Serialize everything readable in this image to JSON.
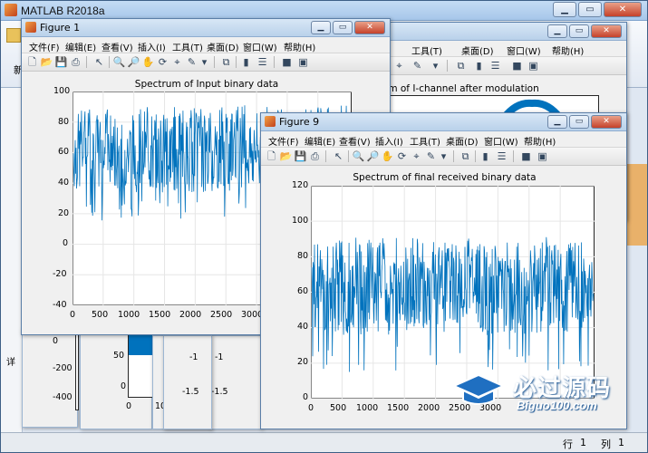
{
  "main_window": {
    "title": "MATLAB R2018a",
    "ribbon_text": "新",
    "left_text": "详",
    "status_row_label": "行",
    "status_row_value": "1",
    "status_col_label": "列",
    "status_col_value": "1"
  },
  "window_buttons": {
    "minimize": "▁",
    "maximize": "▭",
    "close": "✕"
  },
  "menu": [
    "文件(F)",
    "编辑(E)",
    "查看(V)",
    "插入(I)",
    "工具(T)",
    "桌面(D)",
    "窗口(W)",
    "帮助(H)"
  ],
  "toolbar_icons": [
    "new-file-icon",
    "open-folder-icon",
    "save-icon",
    "print-icon",
    "pointer-icon",
    "zoom-in-icon",
    "zoom-out-icon",
    "pan-hand-icon",
    "rotate-icon",
    "data-cursor-icon",
    "brush-icon",
    "dropdown-arrow-icon",
    "link-icon",
    "colorbar-icon",
    "legend-icon",
    "hide-plot-tools-icon",
    "show-plot-tools-icon"
  ],
  "figure1": {
    "title": "Figure 1",
    "plot_title": "Spectrum of Input binary data",
    "yticks": [
      "100",
      "80",
      "60",
      "40",
      "20",
      "0",
      "-20",
      "-40"
    ],
    "xticks": [
      "0",
      "500",
      "1000",
      "1500",
      "2000",
      "2500",
      "3000"
    ]
  },
  "figure_back": {
    "plot_title_partial": "ectrum of I-channel after modulation",
    "menu_visible": [
      "工具(T)",
      "桌面(D)",
      "窗口(W)",
      "帮助(H)"
    ]
  },
  "behind_fragments": {
    "yticks_left": [
      "-200",
      "-400"
    ],
    "yticks_left_top": [
      "0"
    ],
    "yticks_mid": [
      "50",
      "0"
    ],
    "xtick_mid": "0",
    "xtick_mid2": "10",
    "yticks_right": [
      "-1",
      "-1.5"
    ]
  },
  "figure9": {
    "title": "Figure 9",
    "plot_title": "Spectrum of final received binary data",
    "yticks": [
      "120",
      "100",
      "80",
      "60",
      "40",
      "20",
      "0"
    ],
    "xticks": [
      "0",
      "500",
      "1000",
      "1500",
      "2000",
      "2500",
      "3000"
    ]
  },
  "watermark": {
    "text": "必过源码",
    "sub": "Biguo100.com"
  },
  "colors": {
    "series": "#0072bd",
    "titlebar": "#b9d1ea",
    "background": "#6f9ac4"
  },
  "chart_data": [
    {
      "type": "line",
      "title": "Spectrum of Input binary data",
      "xlim": [
        0,
        4000
      ],
      "ylim": [
        -40,
        100
      ],
      "note_series_band": "values fluctuate mostly between 30 and 85 with dips down to about 15",
      "series": [
        {
          "values_summary": [
            85,
            60,
            30
          ]
        }
      ]
    },
    {
      "type": "line",
      "title": "Spectrum of final received binary data",
      "xlim": [
        0,
        4000
      ],
      "ylim": [
        0,
        120
      ],
      "series": [
        {
          "values_summary": [
            85,
            62,
            30
          ]
        }
      ]
    }
  ]
}
